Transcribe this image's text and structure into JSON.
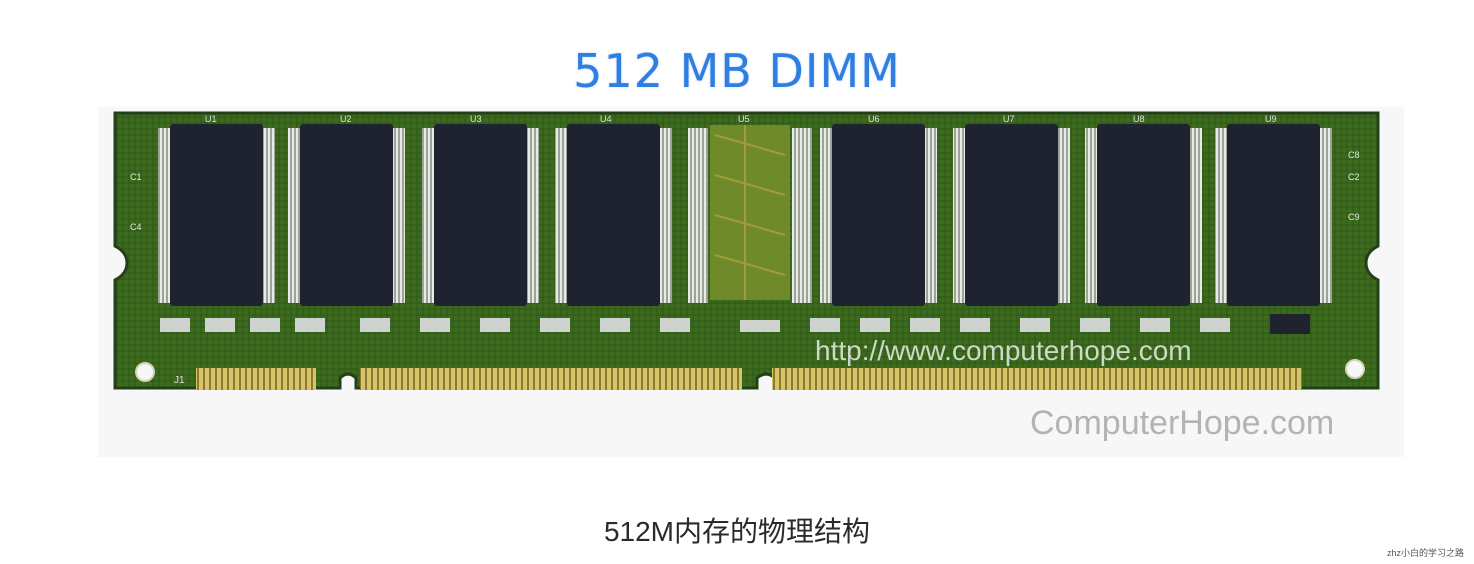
{
  "image": {
    "title": "512 MB DIMM",
    "board_url_text": "http://www.computerhope.com",
    "watermark": "ComputerHope.com",
    "chip_labels": [
      "U1",
      "U2",
      "U3",
      "U4",
      "U5",
      "U6",
      "U7",
      "U8",
      "U9"
    ],
    "board_marks": {
      "left_caps": [
        "C1",
        "C4"
      ],
      "bottom_left": "J1",
      "right_caps": [
        "C8",
        "C2",
        "C9"
      ]
    },
    "colors": {
      "pcb": "#3f6b1e",
      "pcb_dark": "#22401a",
      "chip": "#1f2330",
      "gold": "#c9b25a",
      "title_blue": "#2f7fe3"
    }
  },
  "caption": "512M内存的物理结构",
  "corner_watermark": "zhz小白的学习之路"
}
